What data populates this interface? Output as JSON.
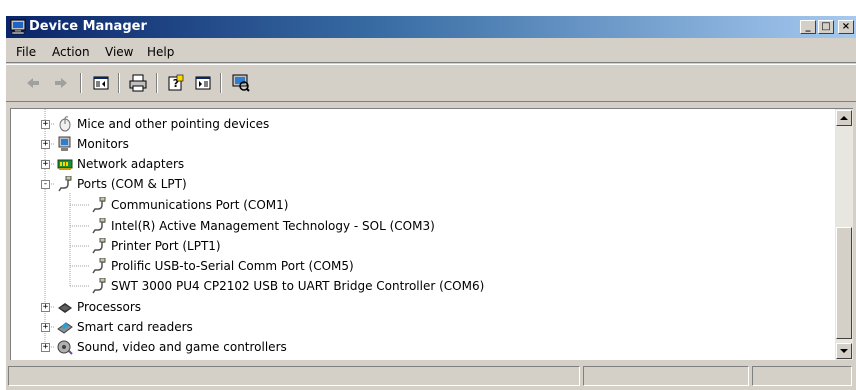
{
  "window": {
    "title": "Device Manager",
    "controls": {
      "minimize": "_",
      "maximize": "□",
      "close": "×"
    }
  },
  "menu": {
    "items": [
      "File",
      "Action",
      "View",
      "Help"
    ]
  },
  "toolbar": {
    "buttons": [
      "back-icon",
      "forward-icon",
      "console-tree-icon",
      "print-icon",
      "help-icon",
      "action-pane-icon",
      "scan-hardware-icon"
    ]
  },
  "tree": {
    "items": [
      {
        "label": "Mice and other pointing devices",
        "icon": "mouse-icon",
        "expander": "+"
      },
      {
        "label": "Monitors",
        "icon": "monitor-icon",
        "expander": "+"
      },
      {
        "label": "Network adapters",
        "icon": "network-adapter-icon",
        "expander": "+"
      },
      {
        "label": "Ports (COM & LPT)",
        "icon": "port-icon",
        "expander": "-"
      },
      {
        "label": "Communications Port (COM1)",
        "icon": "port-icon"
      },
      {
        "label": "Intel(R) Active Management Technology - SOL (COM3)",
        "icon": "port-icon"
      },
      {
        "label": "Printer Port (LPT1)",
        "icon": "port-icon"
      },
      {
        "label": "Prolific USB-to-Serial Comm Port (COM5)",
        "icon": "port-icon"
      },
      {
        "label": "SWT 3000 PU4 CP2102 USB to UART Bridge Controller (COM6)",
        "icon": "port-icon"
      },
      {
        "label": "Processors",
        "icon": "processor-icon",
        "expander": "+"
      },
      {
        "label": "Smart card readers",
        "icon": "smart-card-icon",
        "expander": "+"
      },
      {
        "label": "Sound, video and game controllers",
        "icon": "sound-icon",
        "expander": "+"
      }
    ]
  },
  "colors": {
    "titlebar_start": "#0a246a",
    "titlebar_end": "#a6caf0",
    "chrome": "#d4d0c8"
  }
}
